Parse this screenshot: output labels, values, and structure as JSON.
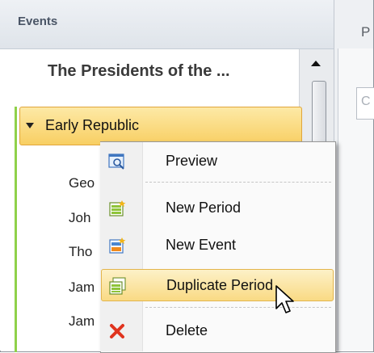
{
  "panel": {
    "title": "Events"
  },
  "project": {
    "title": "The Presidents of the ..."
  },
  "rightpane": {
    "partial_label": "P",
    "partial_field": "C"
  },
  "tree": {
    "group": {
      "label": "Early Republic",
      "expanded": true
    },
    "items": [
      "Geo",
      "Joh",
      "Tho",
      "Jam",
      "Jam"
    ]
  },
  "context_menu": {
    "items": [
      {
        "label": "Preview",
        "icon": "preview-icon"
      },
      {
        "label": "New Period",
        "icon": "new-period-icon"
      },
      {
        "label": "New Event",
        "icon": "new-event-icon"
      },
      {
        "label": "Duplicate Period",
        "icon": "duplicate-period-icon",
        "highlighted": true
      },
      {
        "label": "Delete",
        "icon": "delete-icon"
      }
    ]
  },
  "colors": {
    "highlight": "#f9da84",
    "accent_green": "#8fd14a",
    "delete_red": "#e0341e"
  }
}
